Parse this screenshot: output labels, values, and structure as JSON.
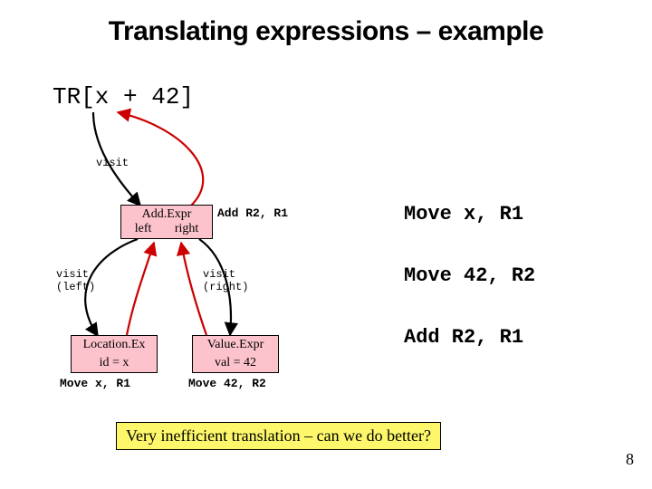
{
  "title": "Translating expressions – example",
  "tr_expr": "TR[x + 42]",
  "visit_top": "visit",
  "add_expr_label": "Add.Expr",
  "add_expr_left": "left",
  "add_expr_right": "right",
  "add_code": "Add R2, R1",
  "visit_left_l1": "visit",
  "visit_left_l2": "(left)",
  "visit_right_l1": "visit",
  "visit_right_l2": "(right)",
  "loc_head": "Location.Ex",
  "loc_sub": "id = x",
  "val_head": "Value.Expr",
  "val_sub": "val = 42",
  "move_x": "Move x, R1",
  "move_42": "Move 42, R2",
  "result1": "Move x, R1",
  "result2": "Move 42, R2",
  "result3": "Add R2, R1",
  "banner": "Very inefficient translation – can we do better?",
  "page_number": "8"
}
